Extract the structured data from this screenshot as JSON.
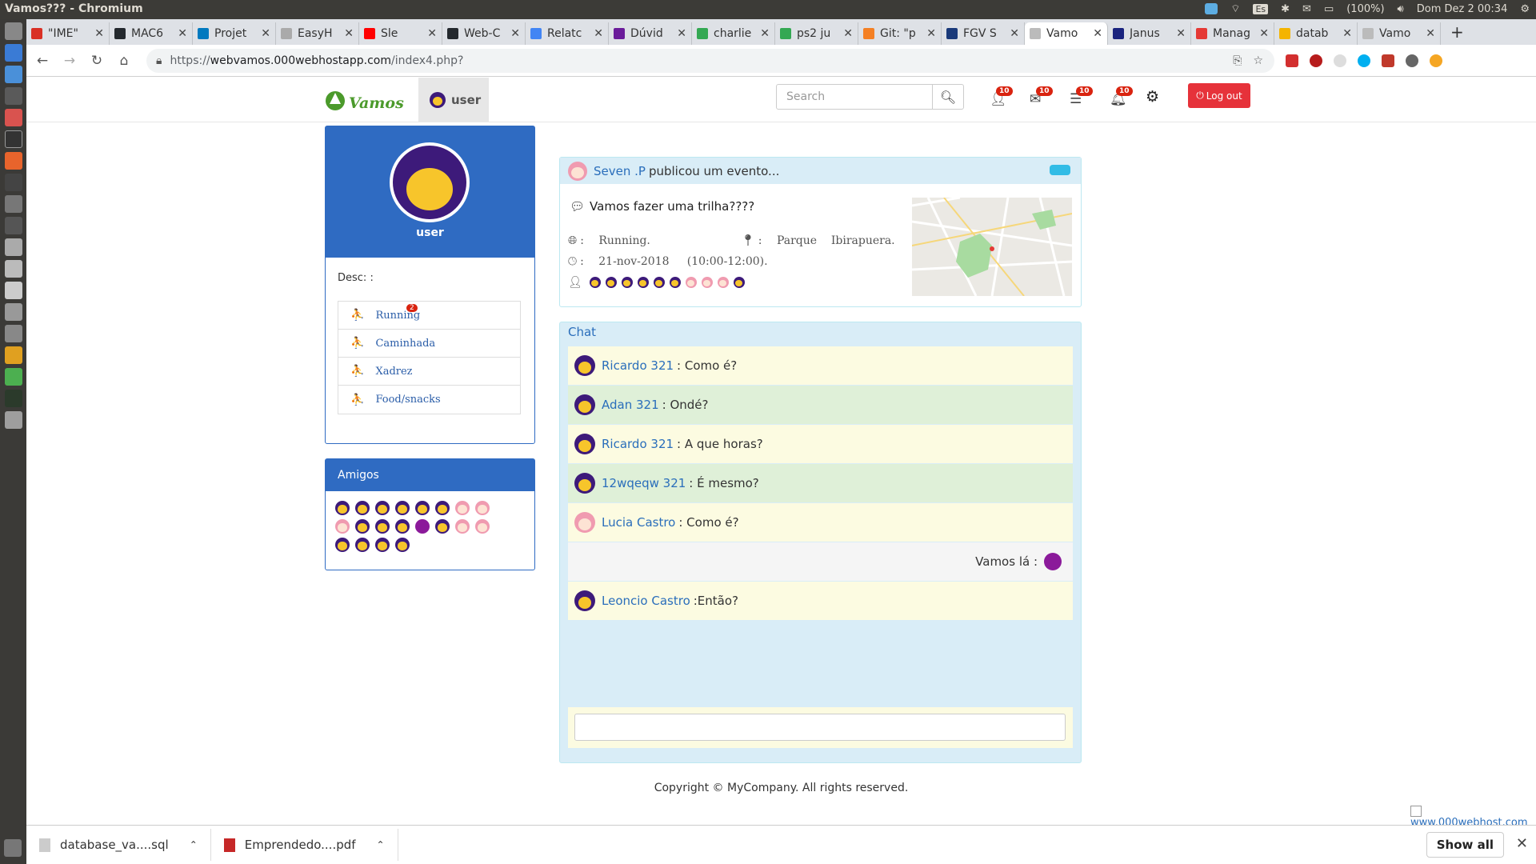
{
  "os": {
    "window_title": "Vamos??? - Chromium",
    "lang": "Es",
    "battery": "(100%)",
    "clock": "Dom Dez  2 00:34"
  },
  "browser": {
    "tabs": [
      {
        "label": "\"IME\"",
        "fav": "#d93025"
      },
      {
        "label": "MAC6",
        "fav": "#24292e"
      },
      {
        "label": "Projet",
        "fav": "#0079bf"
      },
      {
        "label": "EasyH",
        "fav": "#aaaaaa"
      },
      {
        "label": "Sle",
        "fav": "#ff0000"
      },
      {
        "label": "Web-C",
        "fav": "#24292e"
      },
      {
        "label": "Relatc",
        "fav": "#4285f4"
      },
      {
        "label": "Dúvid",
        "fav": "#6a1b9a"
      },
      {
        "label": "charlie",
        "fav": "#34a853"
      },
      {
        "label": "ps2 ju",
        "fav": "#34a853"
      },
      {
        "label": "Git: \"p",
        "fav": "#f48024"
      },
      {
        "label": "FGV S",
        "fav": "#1a3a7a"
      },
      {
        "label": "Vamo",
        "fav": "#bbbbbb",
        "active": true
      },
      {
        "label": "Janus",
        "fav": "#1a237e"
      },
      {
        "label": "Manag",
        "fav": "#e53935"
      },
      {
        "label": "datab",
        "fav": "#f4b400"
      },
      {
        "label": "Vamo",
        "fav": "#bbbbbb"
      }
    ],
    "url_prefix": "https://",
    "url_host": "webvamos.000webhostapp.com",
    "url_path": "/index4.php?"
  },
  "navbar": {
    "logo_text": "Vamos!",
    "user": "user",
    "search_placeholder": "Search",
    "badges": [
      "10",
      "10",
      "10",
      "10"
    ],
    "logout": "Log out"
  },
  "profile": {
    "name": "user",
    "desc": "Desc: :",
    "activities": [
      {
        "label": "Running",
        "badge": "2"
      },
      {
        "label": "Caminhada",
        "badge": ""
      },
      {
        "label": "Xadrez",
        "badge": ""
      },
      {
        "label": "Food/snacks",
        "badge": ""
      }
    ]
  },
  "amigos": {
    "title": "Amigos",
    "avatars": [
      "y",
      "y",
      "y",
      "y",
      "y",
      "y",
      "p",
      "p",
      "p",
      "y",
      "y",
      "y",
      "u",
      "y",
      "p",
      "p",
      "y",
      "y",
      "y",
      "y"
    ]
  },
  "event": {
    "author": "Seven .P",
    "action": "publicou um evento...",
    "title": "Vamos fazer uma trilha????",
    "activity": "Running.",
    "place": "Parque    Ibirapuera.",
    "date": "21-nov-2018     (10:00-12:00).",
    "participants": [
      "y",
      "y",
      "y",
      "y",
      "y",
      "y",
      "p",
      "p",
      "p",
      "y"
    ],
    "accent": "#32bce6"
  },
  "chat": {
    "title": "Chat",
    "messages": [
      {
        "user": "Ricardo 321",
        "text": ": Como é?",
        "style": "y",
        "avatar": "y"
      },
      {
        "user": "Adan 321",
        "text": ": Ondé?",
        "style": "g",
        "avatar": "y"
      },
      {
        "user": "Ricardo 321",
        "text": ": A que horas?",
        "style": "y",
        "avatar": "y"
      },
      {
        "user": "12wqeqw 321",
        "text": ": É mesmo?",
        "style": "g",
        "avatar": "y"
      },
      {
        "user": "Lucia Castro",
        "text": ": Como é?",
        "style": "y",
        "avatar": "p"
      },
      {
        "user": "",
        "text": "Vamos lá :",
        "style": "w",
        "avatar": "u"
      },
      {
        "user": "Leoncio Castro",
        "text": ":Então?",
        "style": "y",
        "avatar": "y"
      }
    ]
  },
  "footer": {
    "copyright": "Copyright © MyCompany. All rights reserved.",
    "host_link": "www.000webhost.com"
  },
  "downloads": {
    "items": [
      {
        "name": "database_va....sql",
        "icon": "#cccccc"
      },
      {
        "name": "Emprendedo....pdf",
        "icon": "#c62828"
      }
    ],
    "show_all": "Show all"
  }
}
